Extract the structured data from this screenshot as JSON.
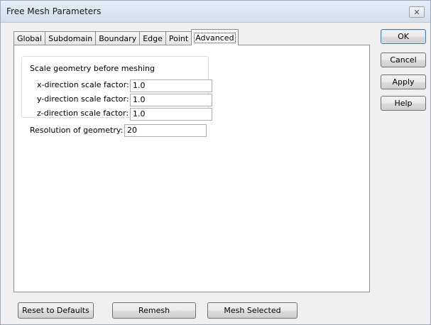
{
  "window": {
    "title": "Free Mesh Parameters",
    "close_glyph": "✕"
  },
  "tabs": [
    {
      "label": "Global"
    },
    {
      "label": "Subdomain"
    },
    {
      "label": "Boundary"
    },
    {
      "label": "Edge"
    },
    {
      "label": "Point"
    },
    {
      "label": "Advanced",
      "active": true
    }
  ],
  "advanced": {
    "scale_group_title": "Scale geometry before meshing",
    "x_label": "x-direction scale factor:",
    "x_value": "1.0",
    "y_label": "y-direction scale factor:",
    "y_value": "1.0",
    "z_label": "z-direction scale factor:",
    "z_value": "1.0",
    "resolution_label": "Resolution of geometry:",
    "resolution_value": "20"
  },
  "side_buttons": {
    "ok": "OK",
    "cancel": "Cancel",
    "apply": "Apply",
    "help": "Help"
  },
  "bottom_buttons": {
    "reset": "Reset to Defaults",
    "remesh": "Remesh",
    "mesh_selected": "Mesh Selected"
  },
  "colors": {
    "title_bar": "#dce5f0",
    "panel": "#ffffff",
    "dialog": "#f0f0f0",
    "default_button_border": "#3c7fb1"
  }
}
